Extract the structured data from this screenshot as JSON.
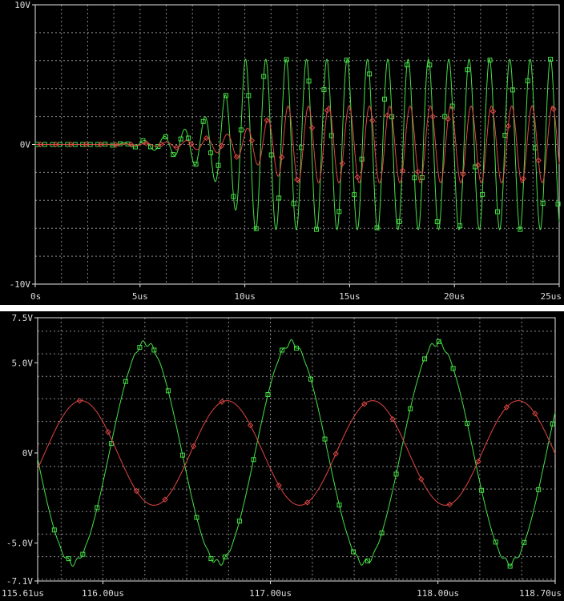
{
  "colors": {
    "background": "#000000",
    "frame": "#ffffff",
    "grid": "#8a8a8a",
    "series_a": "#46e046",
    "series_b": "#e04646",
    "label": "#dcdcdc"
  },
  "chart_data": [
    {
      "type": "line",
      "title": "",
      "xlabel": "",
      "ylabel": "",
      "xlim": [
        0,
        25
      ],
      "ylim": [
        -10,
        10
      ],
      "x_unit": "us",
      "y_unit": "V",
      "grid": true,
      "x_ticks": [
        0,
        5,
        10,
        15,
        20,
        25
      ],
      "x_tick_labels": [
        "0s",
        "5us",
        "10us",
        "15us",
        "20us",
        "25us"
      ],
      "y_ticks": [
        10,
        0,
        -10
      ],
      "y_tick_labels": [
        "10V",
        "0V",
        "-10V"
      ],
      "x_grid_step": 1.25,
      "y_grid_step": 2,
      "series": [
        {
          "color": "#46e046",
          "marker": "square",
          "description": "growing oscillation, period ~0.97us, onset ~3us, saturating near +6V / -6V from ~10us",
          "period": 0.97,
          "start": 3.0,
          "peak_at": 10.0,
          "amp_max": 6.1
        },
        {
          "color": "#e04646",
          "marker": "diamond",
          "description": "growing oscillation, period ~0.97us, amplitude saturating near 2.8V",
          "period": 0.97,
          "start": 3.0,
          "peak_at": 12.0,
          "amp_max": 2.75
        }
      ]
    },
    {
      "type": "line",
      "title": "",
      "xlabel": "",
      "ylabel": "",
      "xlim": [
        115.61,
        118.7
      ],
      "ylim": [
        -7.1,
        7.5
      ],
      "x_unit": "us",
      "y_unit": "V",
      "grid": true,
      "x_ticks": [
        115.61,
        116.0,
        117.0,
        118.0,
        118.7
      ],
      "x_tick_labels": [
        "115.61us",
        "116.00us",
        "117.00us",
        "118.00us",
        "118.70us"
      ],
      "y_ticks": [
        7.5,
        5.0,
        0,
        -5.0,
        -7.1
      ],
      "y_tick_labels": [
        "7.5V",
        "5.0V",
        "0V",
        "-5.0V",
        "-7.1V"
      ],
      "series": [
        {
          "color": "#46e046",
          "marker": "square",
          "description": "steady-state oscillation, amplitude ~6.1V, period ~0.87us",
          "period": 0.87,
          "amp": 6.1,
          "phase_time": 116.255
        },
        {
          "color": "#e04646",
          "marker": "diamond",
          "description": "steady-state oscillation, amplitude ~2.9V, period ~0.87us",
          "period": 0.87,
          "amp": 2.9,
          "phase_time": 115.87
        }
      ]
    }
  ]
}
